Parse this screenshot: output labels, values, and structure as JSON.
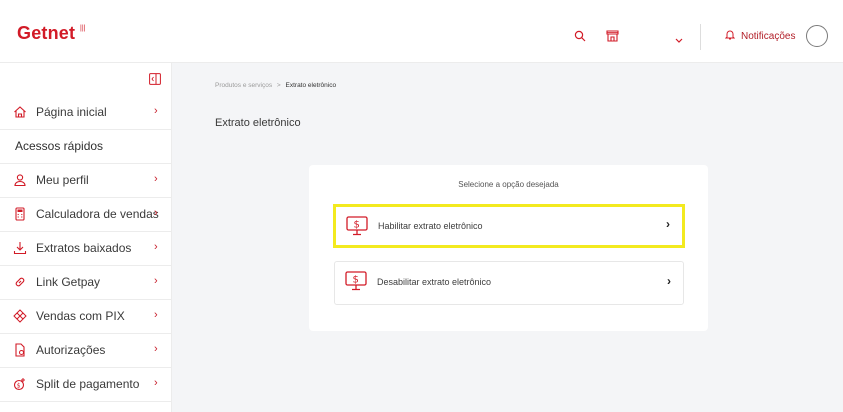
{
  "header": {
    "logo": "Getnet",
    "logo_mark": "|||",
    "notifications_label": "Notificações"
  },
  "sidebar": {
    "items": [
      {
        "label": "Página inicial",
        "icon": "home-icon"
      },
      {
        "label": "Meu perfil",
        "icon": "user-icon"
      },
      {
        "label": "Calculadora de vendas",
        "icon": "calculator-icon"
      },
      {
        "label": "Extratos baixados",
        "icon": "download-icon"
      },
      {
        "label": "Link Getpay",
        "icon": "link-icon"
      },
      {
        "label": "Vendas com PIX",
        "icon": "pix-icon"
      },
      {
        "label": "Autorizações",
        "icon": "authorization-icon"
      },
      {
        "label": "Split de pagamento",
        "icon": "split-payment-icon"
      }
    ],
    "section_label": "Acessos rápidos",
    "chevron": "›"
  },
  "main": {
    "breadcrumb": {
      "parent": "Produtos e serviços",
      "separator": ">",
      "current": "Extrato eletrônico"
    },
    "title": "Extrato eletrônico",
    "card": {
      "prompt": "Selecione a opção desejada",
      "options": [
        {
          "label": "Habilitar extrato eletrônico",
          "icon": "dollar-monitor-icon",
          "highlighted": true
        },
        {
          "label": "Desabilitar extrato eletrônico",
          "icon": "dollar-monitor-icon",
          "highlighted": false
        }
      ],
      "chevron": "›"
    }
  },
  "colors": {
    "brand": "#d21b27",
    "highlight": "#f3ea1f",
    "background": "#f4f5f7"
  }
}
